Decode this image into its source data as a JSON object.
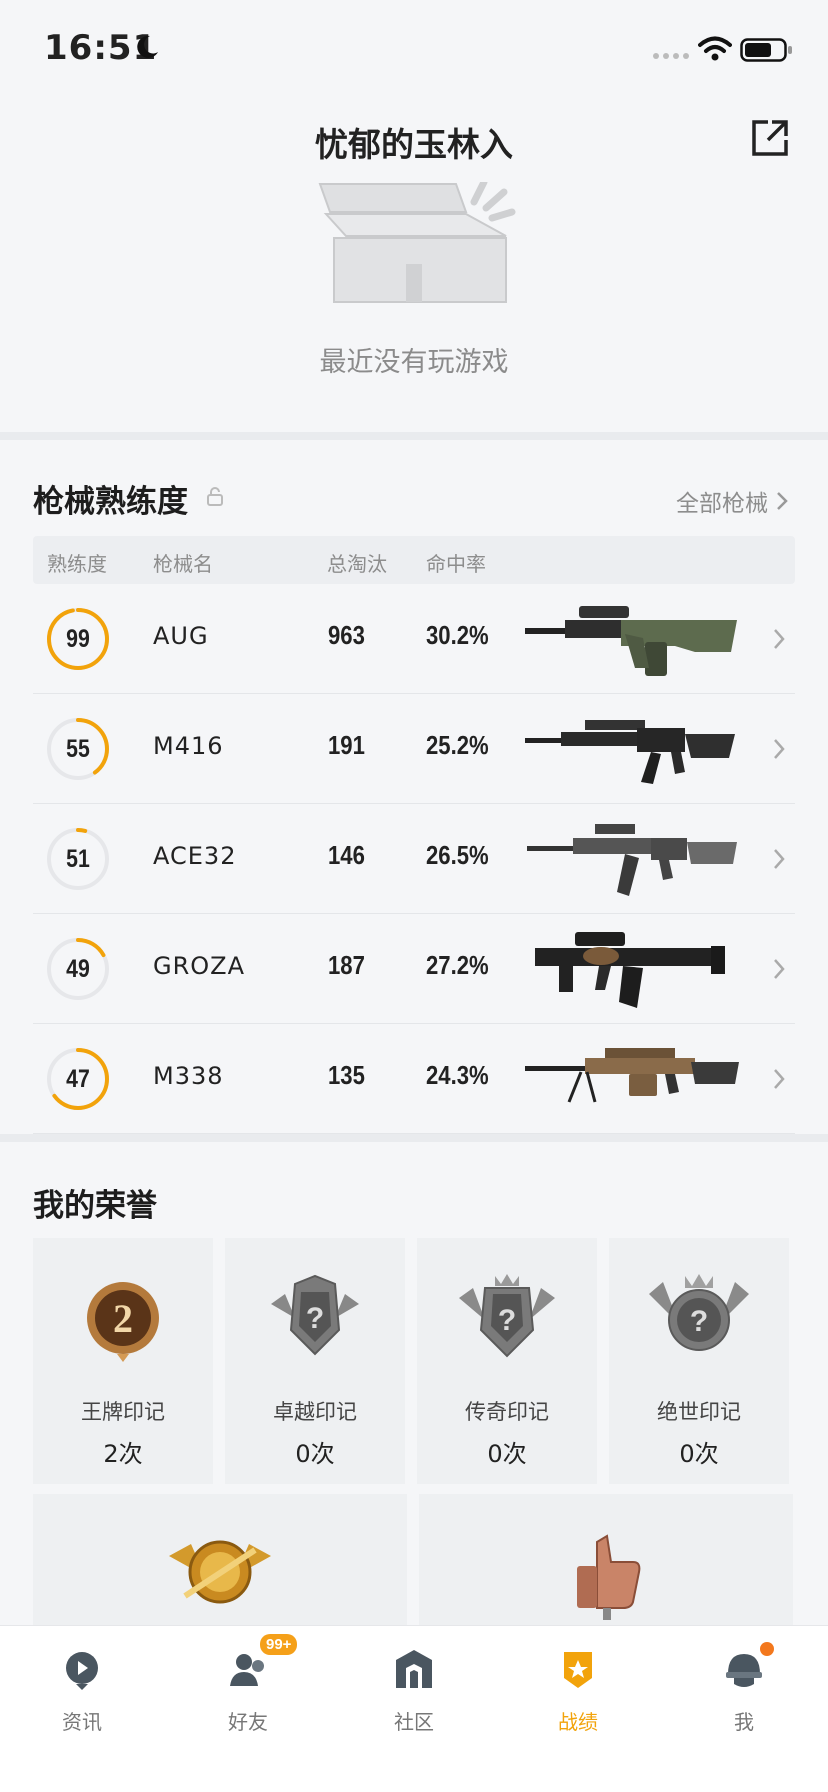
{
  "status": {
    "time": "16:51"
  },
  "header": {
    "title": "忧郁的玉林入",
    "empty_text": "最近没有玩游戏"
  },
  "weapons": {
    "title": "枪械熟练度",
    "all_link": "全部枪械",
    "columns": [
      "熟练度",
      "枪械名",
      "总淘汰",
      "命中率"
    ],
    "rows": [
      {
        "proficiency": "99",
        "name": "AUG",
        "kills": "963",
        "accuracy": "30.2%",
        "progress": 0.97,
        "image": "aug-rifle"
      },
      {
        "proficiency": "55",
        "name": "M416",
        "kills": "191",
        "accuracy": "25.2%",
        "progress": 0.4,
        "image": "m416-rifle"
      },
      {
        "proficiency": "51",
        "name": "ACE32",
        "kills": "146",
        "accuracy": "26.5%",
        "progress": 0.04,
        "image": "ace32-rifle"
      },
      {
        "proficiency": "49",
        "name": "GROZA",
        "kills": "187",
        "accuracy": "27.2%",
        "progress": 0.17,
        "image": "groza-rifle"
      },
      {
        "proficiency": "47",
        "name": "M338",
        "kills": "135",
        "accuracy": "24.3%",
        "progress": 0.65,
        "image": "m338-machine-gun"
      }
    ]
  },
  "honors": {
    "title": "我的荣誉",
    "items": [
      {
        "name": "王牌印记",
        "count": "2次",
        "icon": "ace-medal-icon"
      },
      {
        "name": "卓越印记",
        "count": "0次",
        "icon": "locked-badge-icon"
      },
      {
        "name": "传奇印记",
        "count": "0次",
        "icon": "locked-badge-icon"
      },
      {
        "name": "绝世印记",
        "count": "0次",
        "icon": "locked-badge-icon"
      }
    ]
  },
  "tabs": [
    {
      "label": "资讯",
      "icon": "news-icon"
    },
    {
      "label": "好友",
      "icon": "friends-icon",
      "badge": "99+"
    },
    {
      "label": "社区",
      "icon": "community-icon"
    },
    {
      "label": "战绩",
      "icon": "record-icon",
      "active": true
    },
    {
      "label": "我",
      "icon": "me-icon"
    }
  ],
  "colors": {
    "accent": "#f2a30b",
    "background": "#f5f6f8"
  }
}
